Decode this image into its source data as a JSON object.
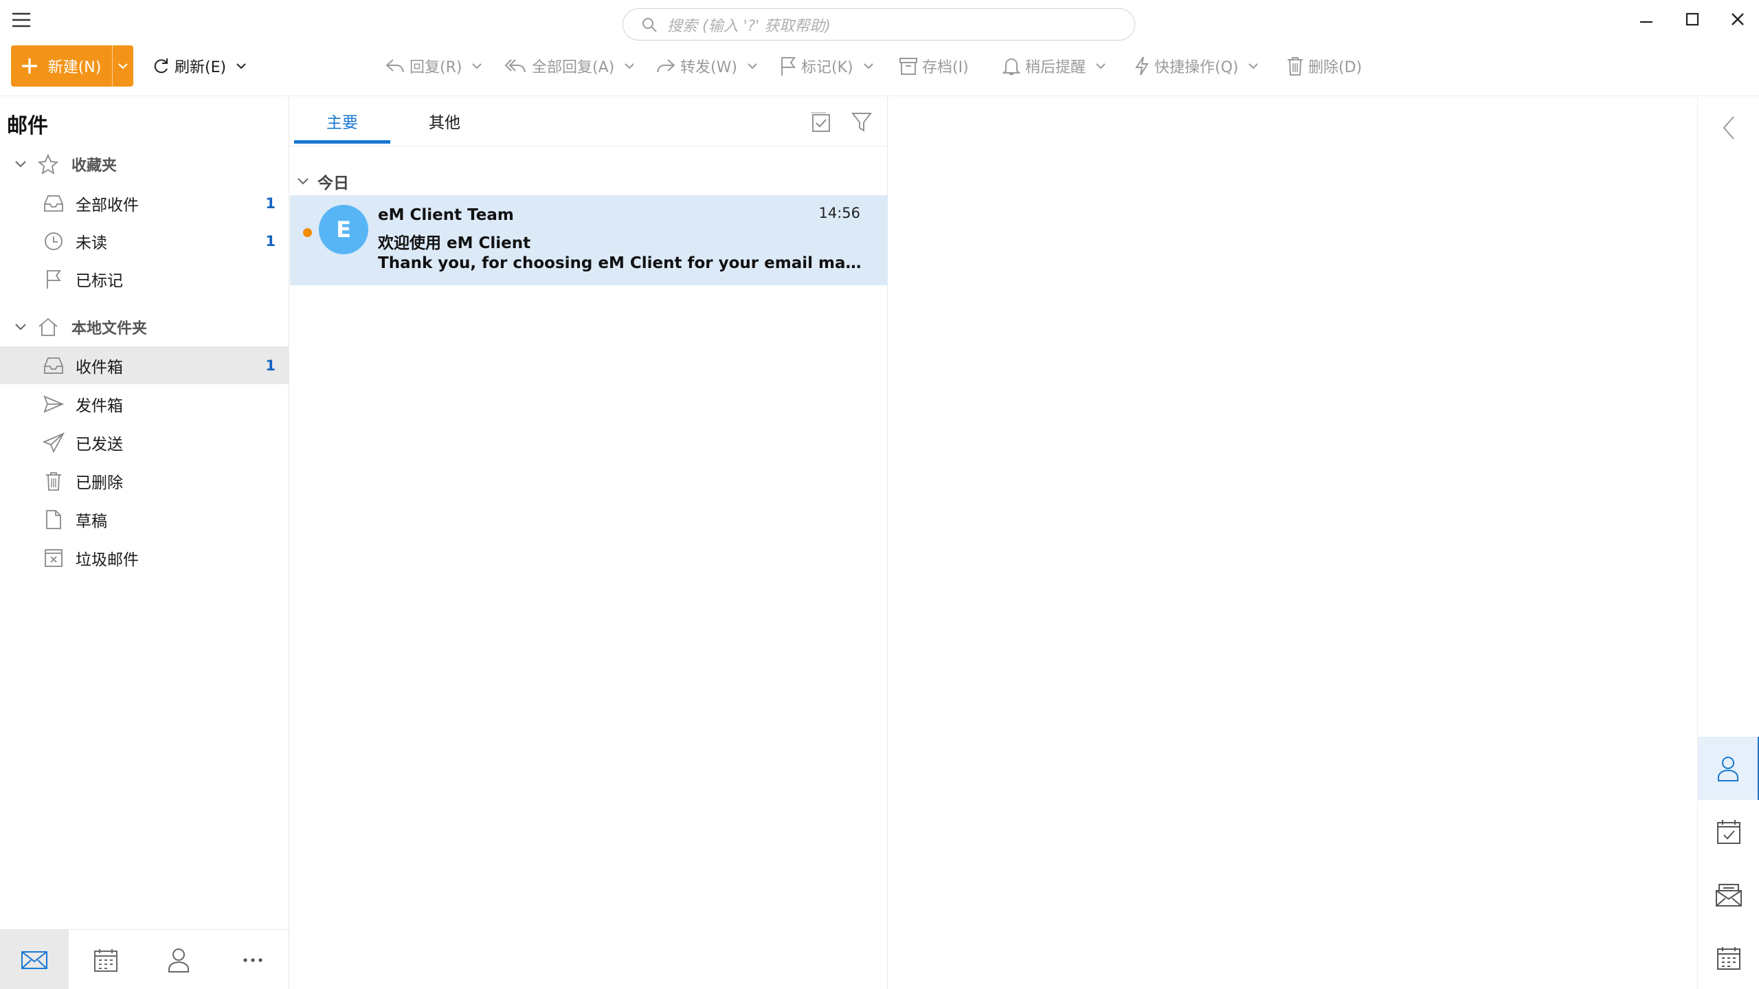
{
  "search": {
    "placeholder": "搜索 (输入 '?' 获取帮助)"
  },
  "window": {
    "minimize_icon": "minimize-icon",
    "maximize_icon": "maximize-icon",
    "close_icon": "close-icon"
  },
  "toolbar": {
    "new_label": "新建(N)",
    "refresh_label": "刷新(E)",
    "reply_label": "回复(R)",
    "reply_all_label": "全部回复(A)",
    "forward_label": "转发(W)",
    "flag_label": "标记(K)",
    "archive_label": "存档(I)",
    "snooze_label": "稍后提醒",
    "quick_actions_label": "快捷操作(Q)",
    "delete_label": "删除(D)"
  },
  "sidebar": {
    "title": "邮件",
    "favorites": {
      "label": "收藏夹",
      "items": [
        {
          "label": "全部收件",
          "count": "1",
          "icon": "inbox-icon"
        },
        {
          "label": "未读",
          "count": "1",
          "icon": "clock-icon"
        },
        {
          "label": "已标记",
          "count": "",
          "icon": "flag-icon"
        }
      ]
    },
    "local": {
      "label": "本地文件夹",
      "items": [
        {
          "label": "收件箱",
          "count": "1",
          "icon": "inbox-icon",
          "active": true
        },
        {
          "label": "发件箱",
          "count": "",
          "icon": "outbox-icon"
        },
        {
          "label": "已发送",
          "count": "",
          "icon": "sent-icon"
        },
        {
          "label": "已删除",
          "count": "",
          "icon": "trash-icon"
        },
        {
          "label": "草稿",
          "count": "",
          "icon": "draft-icon"
        },
        {
          "label": "垃圾邮件",
          "count": "",
          "icon": "junk-icon"
        }
      ]
    }
  },
  "bottom_nav": [
    "mail-icon",
    "calendar-icon",
    "contacts-icon",
    "more-icon"
  ],
  "list": {
    "tabs": [
      {
        "label": "主要",
        "active": true
      },
      {
        "label": "其他",
        "active": false
      }
    ],
    "group_label": "今日",
    "messages": [
      {
        "avatar_letter": "E",
        "sender": "eM Client Team",
        "time": "14:56",
        "subject": "欢迎使用 eM Client",
        "preview": "Thank you, for choosing eM Client for your email management. We hope you enjoy it.",
        "unread": true
      }
    ]
  },
  "rail": [
    "collapse-left-icon",
    "contact-icon",
    "task-icon",
    "mail-stack-icon",
    "calendar-icon"
  ],
  "colors": {
    "accent": "#1877d2",
    "new_button": "#f39418",
    "selected_row": "#dceaf8",
    "avatar": "#57b5f6",
    "unread_dot": "#f08c00"
  }
}
